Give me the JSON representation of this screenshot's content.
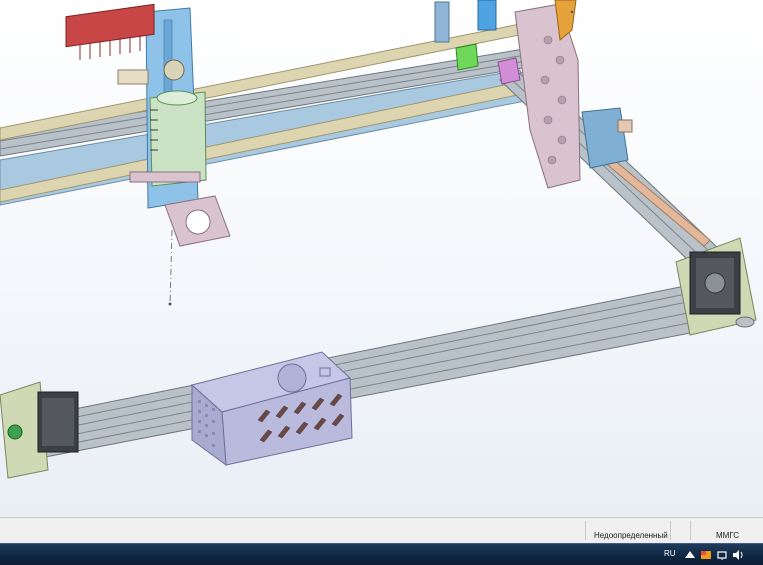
{
  "statusbar": {
    "state_text": "Недоопределенный",
    "units_text": "ММГС"
  },
  "taskbar": {
    "language": "RU",
    "tray_icons": [
      "arrow-up-icon",
      "flag-icon",
      "network-icon",
      "volume-icon"
    ]
  },
  "colors": {
    "rail": "#b9c2c8",
    "rod": "#dcd5b0",
    "motor": "#3c3f44",
    "plate_pink": "#d9c3cf",
    "carriage_blue": "#7fb0d4",
    "panel_blue": "#a9c9e0",
    "red_part": "#c94646",
    "box_lavender": "#c6c7e6",
    "bracket_green": "#cfd9b4",
    "taskbar": "#0f2640"
  }
}
